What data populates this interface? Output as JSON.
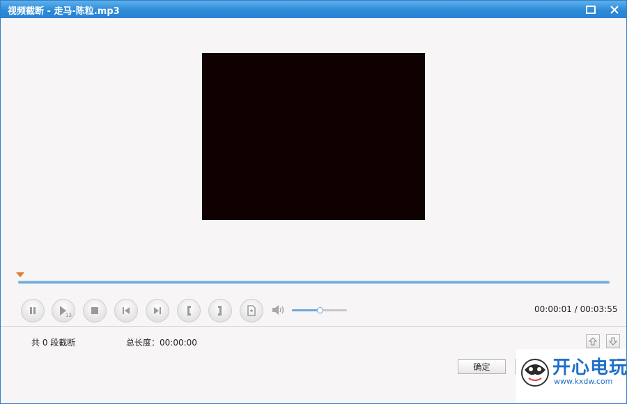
{
  "window": {
    "title": "视频截断 - 走马-陈粒.mp3",
    "maximize_icon": "maximize-icon",
    "close_icon": "close-icon"
  },
  "colors": {
    "titlebar": "#2c8ad8",
    "video_bg": "#0f0001",
    "seek_track": "#5a9fd6",
    "seek_marker": "#e07a2e",
    "watermark_blue": "#1f6fc9"
  },
  "playback": {
    "volume_level": 0.5,
    "current_time": "00:00:01",
    "total_time": "00:03:55",
    "separator": " / "
  },
  "controls": [
    {
      "name": "pause-button",
      "icon": "pause-icon"
    },
    {
      "name": "step-play-button",
      "icon": "play-step-icon",
      "badge": "13"
    },
    {
      "name": "stop-button",
      "icon": "stop-icon"
    },
    {
      "name": "previous-button",
      "icon": "skip-back-icon"
    },
    {
      "name": "next-button",
      "icon": "skip-forward-icon"
    },
    {
      "name": "mark-start-button",
      "icon": "bracket-left-icon"
    },
    {
      "name": "mark-end-button",
      "icon": "bracket-right-icon"
    },
    {
      "name": "add-segment-button",
      "icon": "document-add-icon"
    }
  ],
  "segments": {
    "count_label": "共 0 段截断",
    "total_label": "总长度：00:00:00"
  },
  "buttons": {
    "ok_label": "确定"
  },
  "watermark": {
    "text": "开心电玩",
    "url": "www.kxdw.com"
  }
}
